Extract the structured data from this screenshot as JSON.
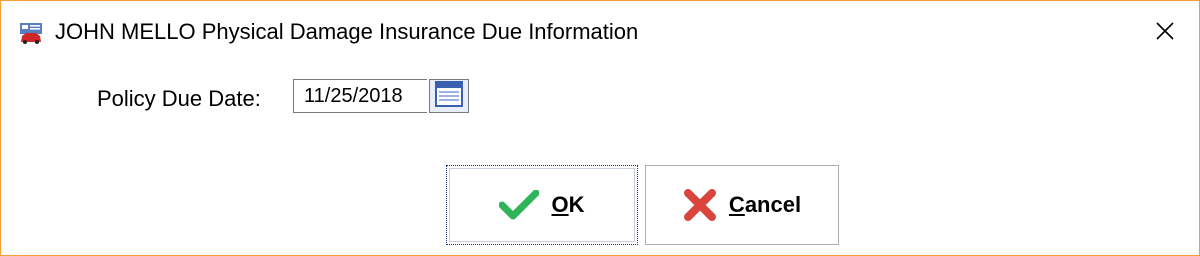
{
  "window": {
    "title": "JOHN MELLO Physical Damage Insurance Due Information",
    "app_icon": "car-insurance-icon",
    "close_icon": "close-icon"
  },
  "form": {
    "policy_due_date_label": "Policy Due Date:",
    "policy_due_date_value": "11/25/2018",
    "calendar_icon": "calendar-icon"
  },
  "buttons": {
    "ok_label_first": "O",
    "ok_label_rest": "K",
    "ok_icon": "checkmark-icon",
    "cancel_label_first": "C",
    "cancel_label_rest": "ancel",
    "cancel_icon": "x-icon"
  },
  "colors": {
    "window_border": "#f0a030",
    "ok_check": "#2fb45a",
    "cancel_x": "#d9453d"
  }
}
